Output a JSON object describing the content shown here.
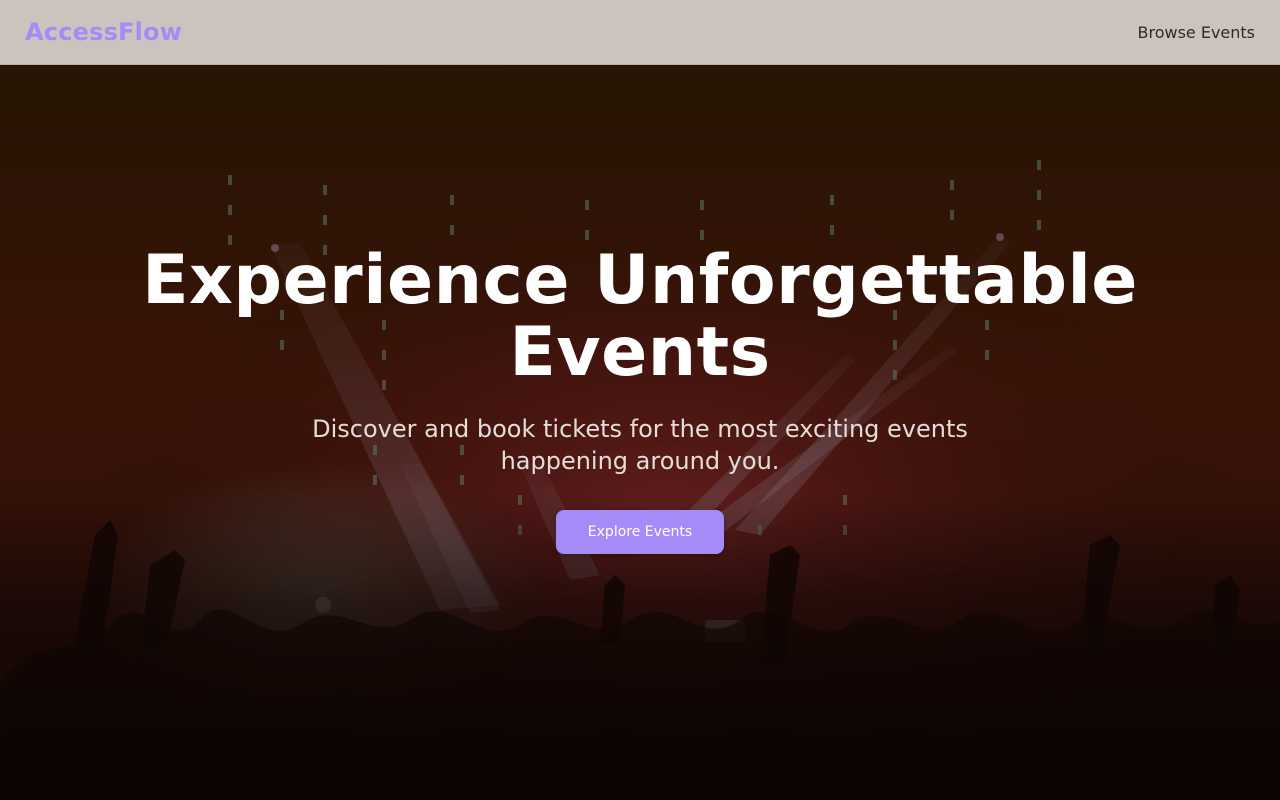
{
  "header": {
    "brand": "AccessFlow",
    "nav_link": "Browse Events"
  },
  "hero": {
    "title": "Experience Unforgettable Events",
    "subtitle": "Discover and book tickets for the most exciting events happening around you.",
    "cta_label": "Explore Events"
  },
  "colors": {
    "accent": "#a58bf7",
    "header_bg": "#cbc3bd",
    "hero_overlay": "#3a1a0c"
  }
}
